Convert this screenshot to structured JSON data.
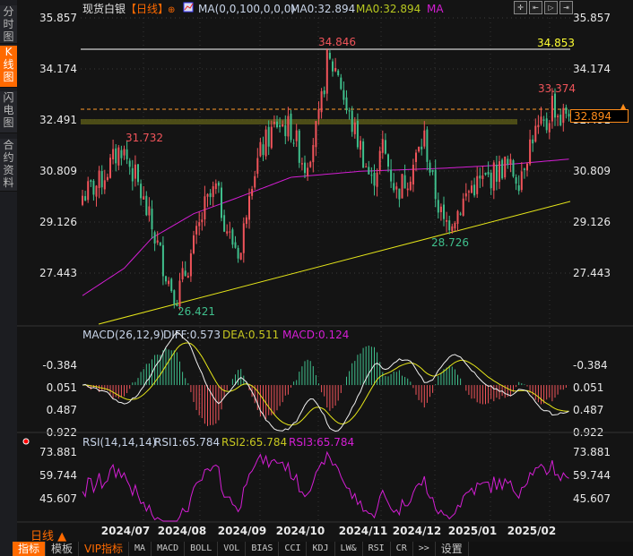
{
  "sidebar": {
    "items": [
      {
        "label": "分时图",
        "active": false
      },
      {
        "label": "K线图",
        "active": true
      },
      {
        "label": "闪电图",
        "active": false
      },
      {
        "label": "合约资料",
        "active": false
      }
    ]
  },
  "header": {
    "instrument": "现货白银",
    "period_tag": "【日线】",
    "ma_params": "MA(0,0,100,0,0,0)",
    "ma0_a": "MA0:32.894",
    "ma0_b": "MA0:32.894",
    "ma_label": "MA"
  },
  "price_axis": {
    "labels": [
      "35.857",
      "34.174",
      "32.491",
      "30.809",
      "29.126",
      "27.443"
    ]
  },
  "annotations": {
    "high": "34.846",
    "low": "26.421",
    "left_high": "31.732",
    "mid_low": "28.726",
    "recent_high": "33.374",
    "hline": "34.853",
    "last_price": "32.894"
  },
  "macd": {
    "title": "MACD(26,12,9)",
    "diff": "DIFF:0.573",
    "dea": "DEA:0.511",
    "macd": "MACD:0.124",
    "axis": [
      "0.922",
      "0.487",
      "0.051",
      "-0.384"
    ]
  },
  "rsi": {
    "title": "RSI(14,14,14)",
    "rsi1": "RSI1:65.784",
    "rsi2": "RSI2:65.784",
    "rsi3": "RSI3:65.784",
    "axis": [
      "73.881",
      "59.744",
      "45.607"
    ]
  },
  "time_axis": [
    "2024/07",
    "2024/08",
    "2024/09",
    "2024/10",
    "2024/11",
    "2024/12",
    "2025/01",
    "2025/02"
  ],
  "period_selector": "日线 ▲",
  "tabs": [
    "指标",
    "模板",
    "VIP指标",
    "MA",
    "MACD",
    "BOLL",
    "VOL",
    "BIAS",
    "CCI",
    "KDJ",
    "LW&",
    "RSI",
    "CR",
    ">>",
    "设置"
  ],
  "colors": {
    "up": "#f0545a",
    "down": "#3fbf8c",
    "ma": "#d41ed4",
    "accent": "#ff6a00",
    "trend": "#e6e619"
  },
  "chart_data": {
    "type": "candlestick",
    "title": "现货白银 日线",
    "price_path": [
      [
        0,
        30.0
      ],
      [
        6,
        30.4
      ],
      [
        14,
        31.6
      ],
      [
        19,
        30.6
      ],
      [
        24,
        29.2
      ],
      [
        31,
        27.2
      ],
      [
        34,
        26.7
      ],
      [
        39,
        28.0
      ],
      [
        44,
        29.6
      ],
      [
        48,
        30.2
      ],
      [
        53,
        28.6
      ],
      [
        57,
        28.1
      ],
      [
        60,
        30.4
      ],
      [
        65,
        31.6
      ],
      [
        70,
        32.4
      ],
      [
        75,
        32.2
      ],
      [
        80,
        31.0
      ],
      [
        85,
        32.4
      ],
      [
        88,
        34.4
      ],
      [
        92,
        34.1
      ],
      [
        95,
        32.8
      ],
      [
        100,
        31.6
      ],
      [
        104,
        30.4
      ],
      [
        108,
        31.6
      ],
      [
        113,
        30.1
      ],
      [
        118,
        30.8
      ],
      [
        123,
        31.9
      ],
      [
        126,
        30.4
      ],
      [
        130,
        29.0
      ],
      [
        135,
        29.5
      ],
      [
        140,
        30.3
      ],
      [
        145,
        30.5
      ],
      [
        152,
        31.0
      ],
      [
        157,
        30.6
      ],
      [
        162,
        32.0
      ],
      [
        167,
        32.3
      ],
      [
        169,
        33.1
      ],
      [
        172,
        32.5
      ],
      [
        175,
        32.9
      ]
    ],
    "ma_path": [
      [
        0,
        26.7
      ],
      [
        15,
        27.6
      ],
      [
        25,
        28.6
      ],
      [
        40,
        29.4
      ],
      [
        55,
        29.9
      ],
      [
        75,
        30.6
      ],
      [
        100,
        30.8
      ],
      [
        130,
        30.9
      ],
      [
        150,
        31.0
      ],
      [
        175,
        31.2
      ]
    ],
    "highs_labeled": [
      34.846,
      31.732,
      33.374
    ],
    "lows_labeled": [
      26.421,
      28.726
    ],
    "ylim": [
      26.0,
      36.2
    ]
  }
}
